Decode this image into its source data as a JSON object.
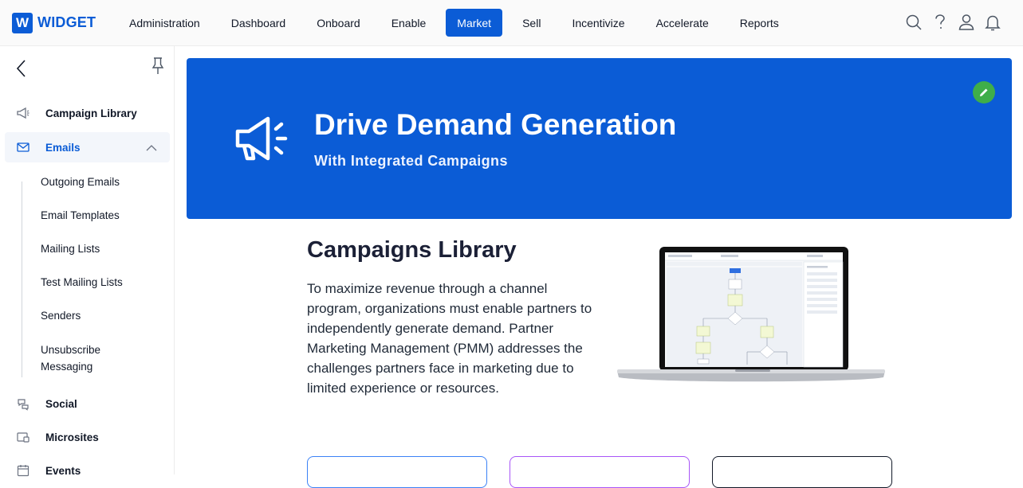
{
  "brand": {
    "badge": "W",
    "name": "WIDGET",
    "color": "#0b5cd6"
  },
  "nav": {
    "items": [
      "Administration",
      "Dashboard",
      "Onboard",
      "Enable",
      "Market",
      "Sell",
      "Incentivize",
      "Accelerate",
      "Reports"
    ],
    "active": "Market"
  },
  "top_icons": [
    "search-icon",
    "help-icon",
    "user-icon",
    "bell-icon"
  ],
  "sidebar": {
    "items": [
      {
        "label": "Campaign Library",
        "icon": "megaphone-icon"
      },
      {
        "label": "Emails",
        "icon": "envelope-icon",
        "expanded": true
      },
      {
        "label": "Social",
        "icon": "social-icon"
      },
      {
        "label": "Microsites",
        "icon": "microsite-icon"
      },
      {
        "label": "Events",
        "icon": "calendar-icon"
      }
    ],
    "email_subitems": [
      "Outgoing Emails",
      "Email Templates",
      "Mailing Lists",
      "Test Mailing Lists",
      "Senders",
      "Unsubscribe",
      "Messaging"
    ]
  },
  "hero": {
    "title": "Drive Demand Generation",
    "subtitle": "With Integrated Campaigns",
    "background": "#0b5cd6",
    "edit_color": "#3fae49"
  },
  "content": {
    "title": "Campaigns Library",
    "text": "To maximize revenue through a channel program, organizations must enable partners to independently generate demand. Partner Marketing Management (PMM) addresses the challenges partners face in marketing due to limited experience or resources."
  },
  "cards": [
    {
      "border_color": "#3b82f6"
    },
    {
      "border_color": "#a855f7"
    },
    {
      "border_color": "#111827"
    }
  ]
}
